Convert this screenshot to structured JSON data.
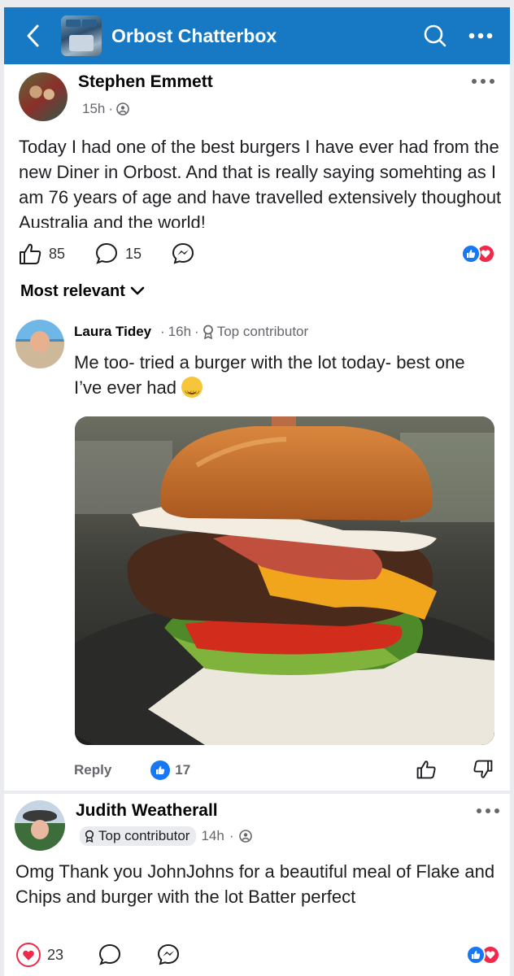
{
  "header": {
    "title": "Orbost Chatterbox",
    "color": "#1778c4"
  },
  "post": {
    "author": "Stephen Emmett",
    "time": "15h",
    "audience_icon": "friends-icon",
    "text": "Today I had one of the best burgers I have ever had from the new Diner in Orbost.  And that is really saying somehting as I am 76 years of age and have travelled extensively thoughout Australia and the world!",
    "likes": "85",
    "comments": "15",
    "reactions": [
      "like",
      "love"
    ]
  },
  "sort": {
    "label": "Most relevant"
  },
  "comments": [
    {
      "author": "Laura Tidey",
      "time": "16h",
      "badge": "Top contributor",
      "text": "Me too- tried a burger with the lot today- best one I’ve ever had",
      "reply_label": "Reply",
      "likes": "17",
      "photo_subject": "burger-photo"
    },
    {
      "author": "Judith Weatherall",
      "badge": "Top contributor",
      "time": "14h",
      "text": "Omg Thank you JohnJohns for a beautiful meal of Flake and Chips and burger with the lot Batter perfect",
      "likes": "23",
      "reactions": [
        "like",
        "love"
      ]
    }
  ],
  "colors": {
    "like_blue": "#1877f2",
    "love_red": "#f02849",
    "secondary_text": "#65676b"
  }
}
